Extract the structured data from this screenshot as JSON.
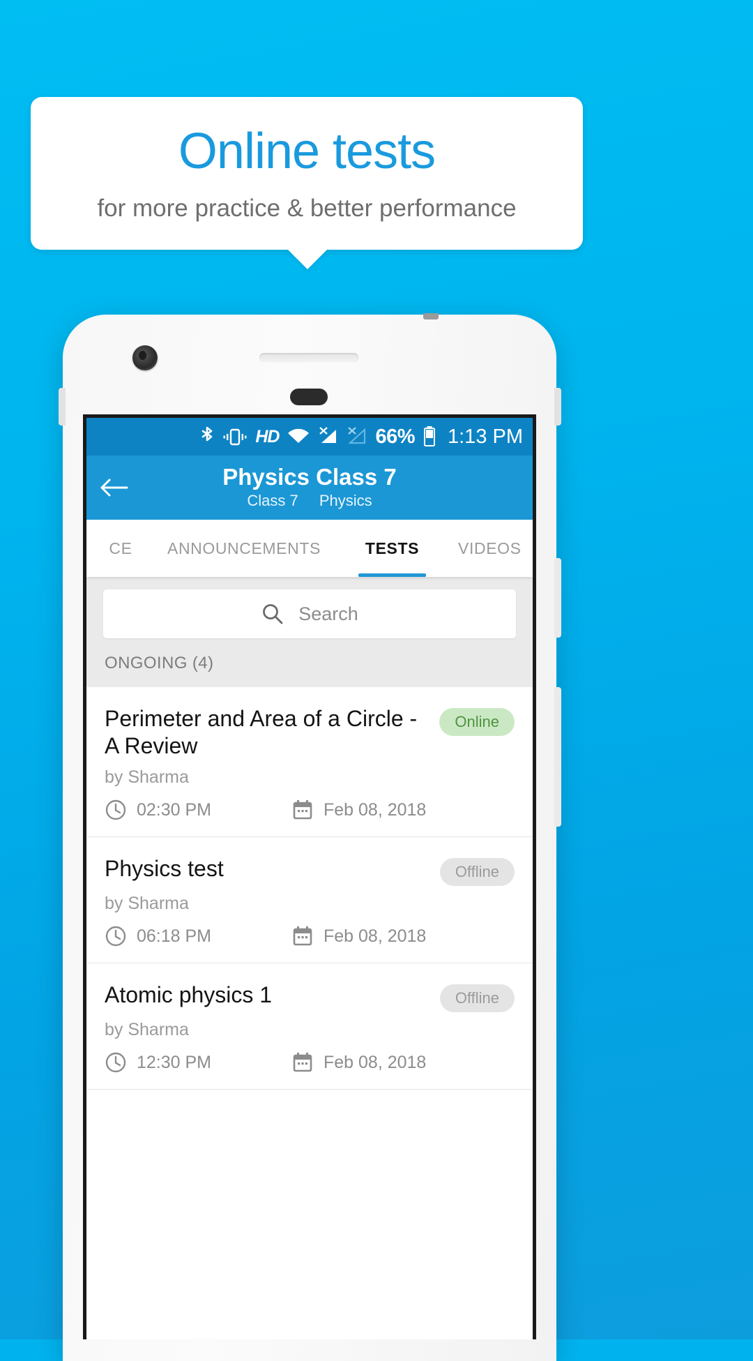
{
  "promo": {
    "title": "Online tests",
    "subtitle": "for more practice & better performance",
    "title_color": "#1a9ade",
    "subtitle_color": "#6e6e6e",
    "background_color": "#00b3ef"
  },
  "status_bar": {
    "icons": [
      "bluetooth-icon",
      "vibrate-icon",
      "hd-icon",
      "wifi-icon",
      "signal-no-sim-1-icon",
      "signal-no-sim-2-icon",
      "battery-icon"
    ],
    "hd_label": "HD",
    "battery_percent": "66%",
    "time": "1:13 PM",
    "background_color": "#0d83c4"
  },
  "toolbar": {
    "back_icon": "arrow-left-icon",
    "title": "Physics Class 7",
    "subtitle_class": "Class 7",
    "subtitle_subject": "Physics",
    "background_color": "#1b97d5"
  },
  "tabs": {
    "items": [
      {
        "label": "CE",
        "active": false
      },
      {
        "label": "ANNOUNCEMENTS",
        "active": false
      },
      {
        "label": "TESTS",
        "active": true
      },
      {
        "label": "VIDEOS",
        "active": false
      }
    ],
    "indicator_color": "#2196d6"
  },
  "search": {
    "icon": "search-icon",
    "placeholder": "Search",
    "value": ""
  },
  "section": {
    "header": "ONGOING (4)"
  },
  "tests": [
    {
      "title": "Perimeter and Area of a Circle - A Review",
      "author": "by Sharma",
      "status": "Online",
      "status_type": "online",
      "time": "02:30 PM",
      "date": "Feb 08, 2018"
    },
    {
      "title": "Physics test",
      "author": "by Sharma",
      "status": "Offline",
      "status_type": "offline",
      "time": "06:18 PM",
      "date": "Feb 08, 2018"
    },
    {
      "title": "Atomic physics 1",
      "author": "by Sharma",
      "status": "Offline",
      "status_type": "offline",
      "time": "12:30 PM",
      "date": "Feb 08, 2018"
    }
  ],
  "colors": {
    "online_badge_bg": "#cbe8c4",
    "online_badge_text": "#4f9441",
    "offline_badge_bg": "#e4e4e4",
    "offline_badge_text": "#9b9b9b"
  }
}
